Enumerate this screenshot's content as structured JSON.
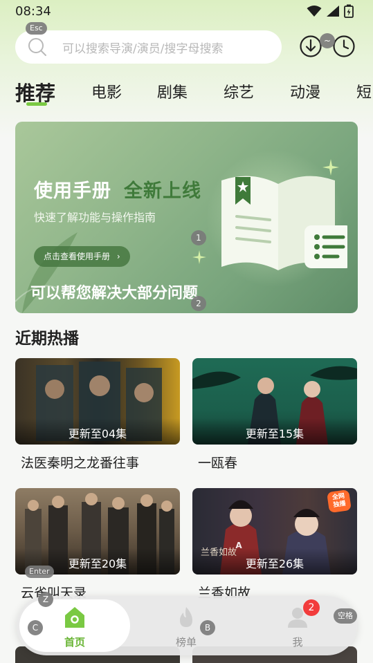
{
  "status": {
    "time": "08:34"
  },
  "search": {
    "placeholder": "可以搜索导演/演员/搜字母搜索",
    "key_hint": "Esc"
  },
  "header": {
    "history_key_hint": "~"
  },
  "tabs": [
    "推荐",
    "电影",
    "剧集",
    "综艺",
    "动漫",
    "短"
  ],
  "banner": {
    "title": "使用手册",
    "title_accent": "全新上线",
    "subtitle": "快速了解功能与操作指南",
    "button": "点击查看使用手册",
    "button_arrow": "›",
    "footer": "可以帮您解决大部分问题",
    "key_hint_1": "1",
    "key_hint_2": "2"
  },
  "section": {
    "title": "近期热播"
  },
  "cards": [
    {
      "title": "法医秦明之龙番往事",
      "episode": "更新至04集"
    },
    {
      "title": "一瓯春",
      "episode": "更新至15集"
    },
    {
      "title": "云雀叫天录",
      "episode": "更新至20集",
      "key_hint": "Enter"
    },
    {
      "title": "兰香如故",
      "episode": "更新至26集",
      "key_hint": "A",
      "badge": "全网\n独播",
      "calligraphy": "兰香如故"
    }
  ],
  "bottom_nav": {
    "items": [
      {
        "label": "首页",
        "key_hint": "C"
      },
      {
        "label": "榜单",
        "key_hint": "B"
      },
      {
        "label": "我",
        "notification": "2",
        "key_hint": "空格"
      }
    ],
    "z_hint": "Z"
  },
  "colors": {
    "accent": "#7ac943",
    "active_nav": "#6ab536",
    "notification": "#f23c3c",
    "hot_badge": "#ff6a2b"
  }
}
